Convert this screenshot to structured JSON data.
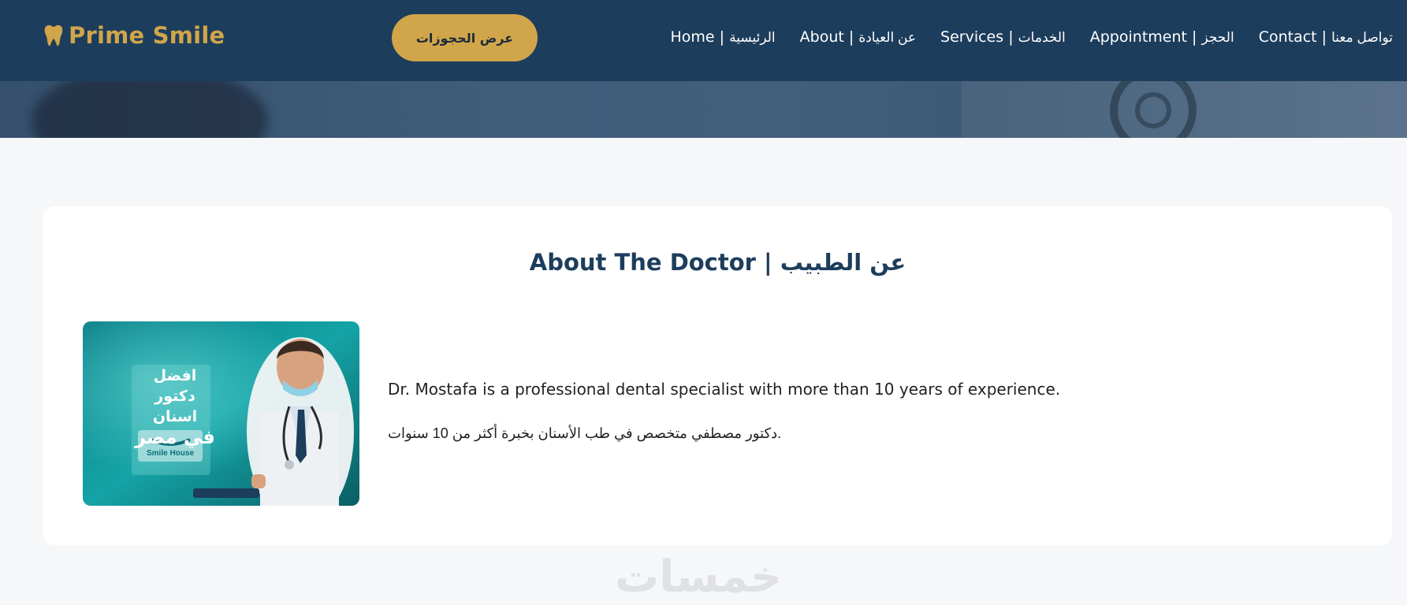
{
  "header": {
    "brand": "Prime Smile",
    "brand_icon": "tooth-icon",
    "bookings_button": "عرض الحجوزات",
    "nav": [
      {
        "en": "Home",
        "ar": "الرئيسية"
      },
      {
        "en": "About",
        "ar": "عن العيادة"
      },
      {
        "en": "Services",
        "ar": "الخدمات"
      },
      {
        "en": "Appointment",
        "ar": "الحجز"
      },
      {
        "en": "Contact",
        "ar": "تواصل معنا"
      }
    ]
  },
  "about": {
    "title": "About The Doctor | عن الطبيب",
    "text_en": "Dr. Mostafa is a professional dental specialist with more than 10 years of experience.",
    "text_ar": "دكتور مصطفي متخصص في طب الأسنان بخبرة أكثر من 10 سنوات.",
    "photo": {
      "headline_line1": "افضل دكتور",
      "headline_line2": "اسنان",
      "headline_line3": "في مصر",
      "clinic_logo": "Smile House"
    }
  },
  "watermark": "خمسات",
  "colors": {
    "navbar": "#1d3d5c",
    "accent": "#d1a54a",
    "title": "#1d3d5c",
    "page_bg": "#f6f7f9"
  }
}
